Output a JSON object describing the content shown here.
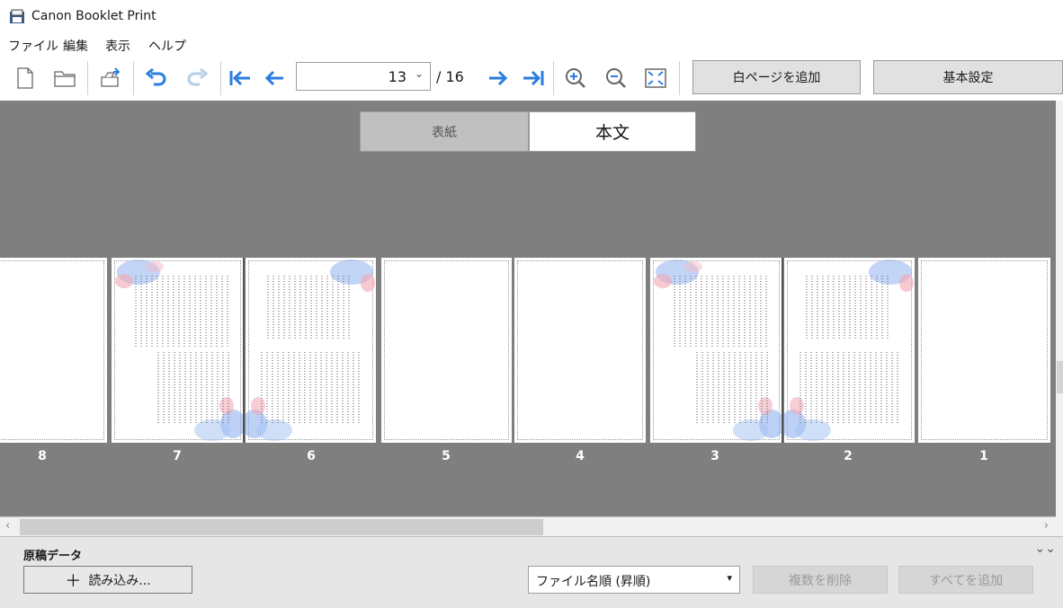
{
  "window": {
    "title": "Canon Booklet Print"
  },
  "menu": [
    "ファイル",
    "編集",
    "表示",
    "ヘルプ"
  ],
  "toolbar": {
    "current_page": "13",
    "total_pages": "/ 16",
    "add_blank_label": "白ページを追加",
    "basic_settings_label": "基本設定"
  },
  "view_tabs": {
    "cover": "表紙",
    "body": "本文"
  },
  "pages": [
    {
      "num": "8",
      "content": "blank"
    },
    {
      "num": "7",
      "content": "text"
    },
    {
      "num": "6",
      "content": "text"
    },
    {
      "num": "5",
      "content": "blank"
    },
    {
      "num": "4",
      "content": "blank"
    },
    {
      "num": "3",
      "content": "text"
    },
    {
      "num": "2",
      "content": "text"
    },
    {
      "num": "1",
      "content": "blank"
    }
  ],
  "bottom_panel": {
    "title": "原稿データ",
    "load_label": "読み込み...",
    "sort_value": "ファイル名順 (昇順)",
    "delete_multiple_label": "複数を削除",
    "add_all_label": "すべてを追加"
  },
  "colors": {
    "accent": "#2b7de1",
    "canvas": "#7f7f7f"
  }
}
